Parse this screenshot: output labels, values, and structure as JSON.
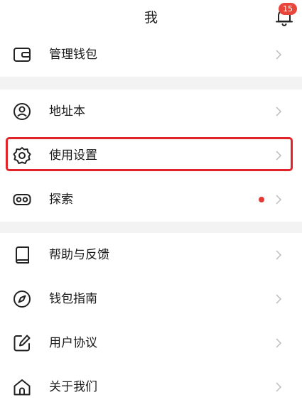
{
  "header": {
    "title": "我",
    "notification_count": "15"
  },
  "menu": {
    "wallet_manage": "管理钱包",
    "address_book": "地址本",
    "settings": "使用设置",
    "explore": "探索",
    "help_feedback": "帮助与反馈",
    "wallet_guide": "钱包指南",
    "user_agreement": "用户协议",
    "about_us": "关于我们"
  },
  "colors": {
    "badge": "#e8463a",
    "highlight_border": "#e0252a",
    "new_dot": "#e53935",
    "section_gap": "#f3f3f4"
  }
}
